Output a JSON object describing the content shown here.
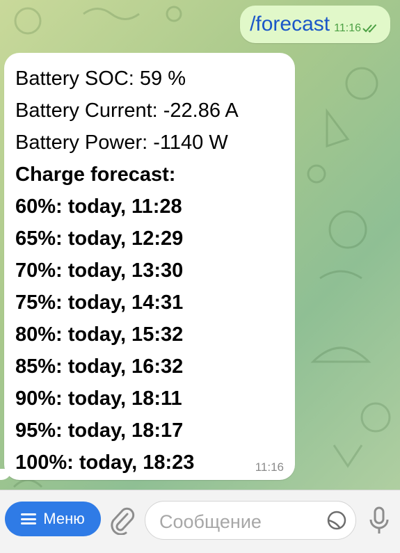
{
  "outgoing_message": {
    "text": "/forecast",
    "time": "11:16"
  },
  "incoming_message": {
    "lines": [
      {
        "text": "Battery SOC: 59 %",
        "bold": false
      },
      {
        "text": "Battery Current: -22.86 A",
        "bold": false
      },
      {
        "text": "Battery Power: -1140 W",
        "bold": false
      },
      {
        "text": "Charge forecast:",
        "bold": true
      },
      {
        "text": "60%: today, 11:28",
        "bold": true
      },
      {
        "text": "65%: today, 12:29",
        "bold": true
      },
      {
        "text": "70%: today, 13:30",
        "bold": true
      },
      {
        "text": "75%: today, 14:31",
        "bold": true
      },
      {
        "text": "80%: today, 15:32",
        "bold": true
      },
      {
        "text": "85%: today, 16:32",
        "bold": true
      },
      {
        "text": "90%: today, 18:11",
        "bold": true
      },
      {
        "text": "95%: today, 18:17",
        "bold": true
      },
      {
        "text": "100%: today, 18:23",
        "bold": true
      }
    ],
    "time": "11:16"
  },
  "input_bar": {
    "menu_label": "Меню",
    "placeholder": "Сообщение"
  },
  "icons": {
    "menu": "menu-icon",
    "attach": "paperclip-icon",
    "sticker": "sticker-icon",
    "mic": "microphone-icon",
    "read": "double-check-icon"
  },
  "colors": {
    "outgoing_bubble": "#e1f8c9",
    "menu_button": "#2f7be6",
    "link_text": "#1a56c8",
    "read_checks": "#4b9f43"
  }
}
